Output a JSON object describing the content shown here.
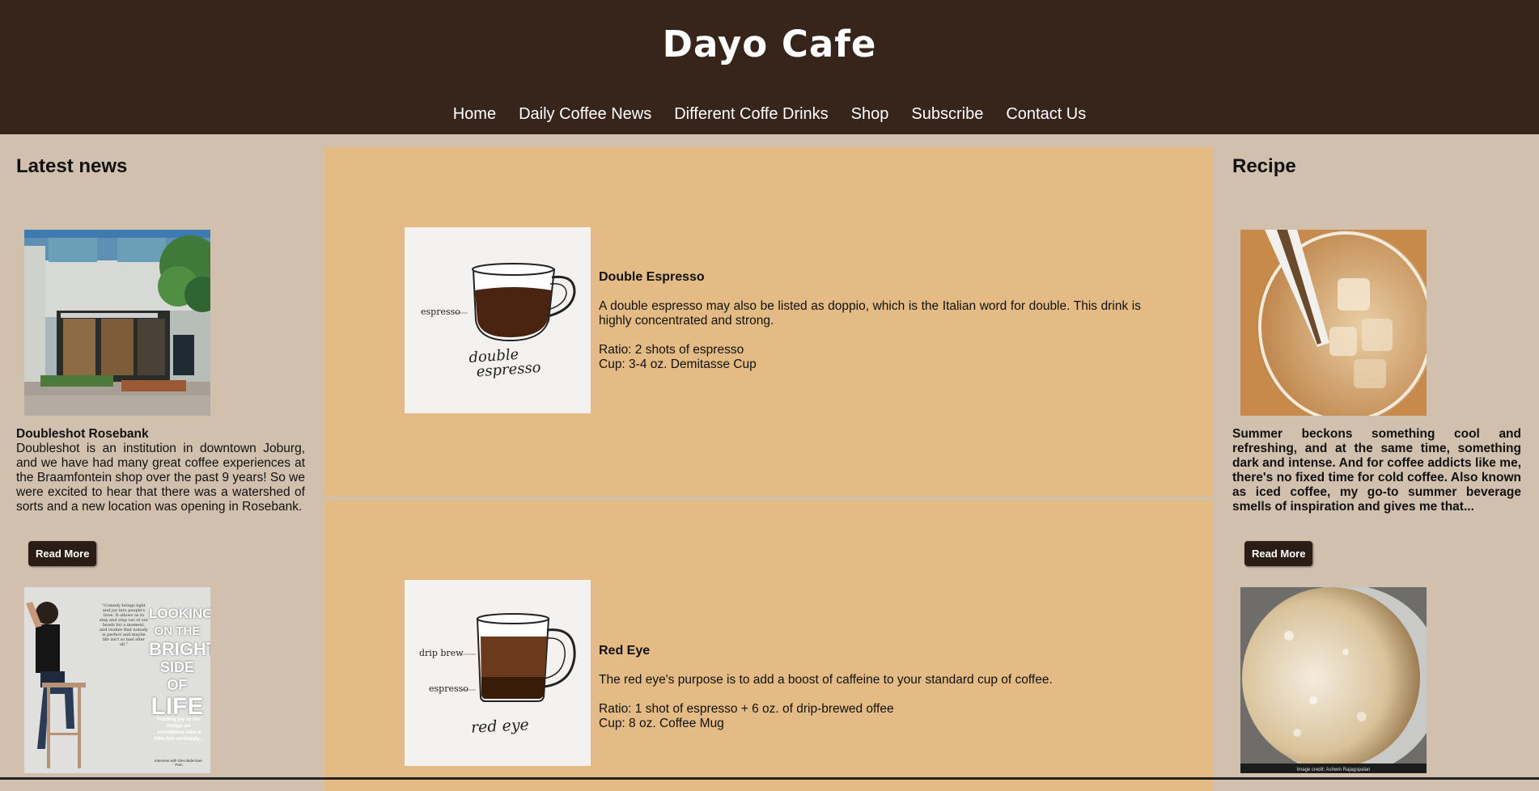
{
  "site": {
    "title": "Dayo Cafe"
  },
  "nav": {
    "items": [
      "Home",
      "Daily Coffee News",
      "Different Coffe Drinks",
      "Shop",
      "Subscribe",
      "Contact Us"
    ]
  },
  "left": {
    "heading": "Latest news",
    "article_title": "Doubleshot Rosebank",
    "article_body": "Doubleshot is an institution in downtown Joburg, and we have had many great coffee experiences at the Braamfontein shop over the past 9 years! So we were excited to hear that there was a watershed of sorts and a new location was opening in Rosebank.",
    "read_more": "Read More",
    "poster": {
      "quote": "\"Comedy brings light and joy into people's lives. It allows us to step and step out of our heads for a moment, and realize that nobody is perfect and maybe life isn't so bad after all.\"",
      "headline": [
        "LOOKING",
        "ON THE",
        "BRIGHT",
        "SIDE OF",
        "LIFE"
      ],
      "tagline": "Finding joy in the things we sometimes take a little too seriously...",
      "credit": "Interview with Glen Biderman-Pam"
    }
  },
  "right": {
    "heading": "Recipe",
    "body": "Summer beckons something cool and refreshing, and at the same time, something dark and intense. And for coffee addicts like me, there's no fixed time for cold coffee. Also known as iced coffee, my go-to summer beverage smells of inspiration and gives me that...",
    "read_more": "Read More",
    "photo_credit": "Image credit: Ashwin Rajagopalan"
  },
  "drinks": [
    {
      "name": "Double Espresso",
      "description": "A double espresso may also be listed as doppio, which is the Italian word for double. This drink is highly concentrated and strong.",
      "ratio": "Ratio: 2 shots of espresso",
      "cup": "Cup: 3-4 oz. Demitasse Cup",
      "diagram_labels": [
        "espresso"
      ],
      "diagram_caption": [
        "double",
        "espresso"
      ]
    },
    {
      "name": "Red Eye",
      "description": "The red eye's purpose is to add a boost of caffeine to your standard cup of coffee.",
      "ratio": "Ratio: 1 shot of espresso + 6 oz. of drip-brewed offee",
      "cup": "Cup: 8 oz. Coffee Mug",
      "diagram_labels": [
        "drip brew",
        "espresso"
      ],
      "diagram_caption": [
        "red eye"
      ]
    }
  ],
  "colors": {
    "header": "#37241b",
    "page": "#d2c0af",
    "card": "#e4bb84",
    "button": "#2b1d16"
  }
}
